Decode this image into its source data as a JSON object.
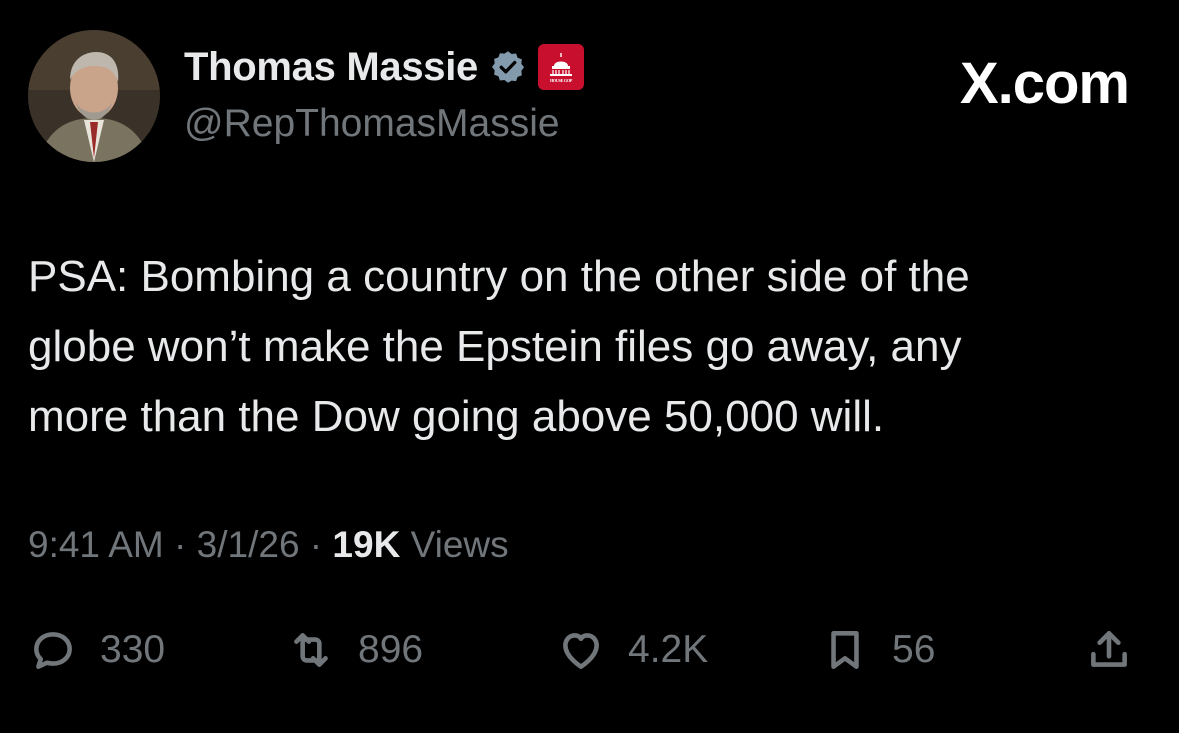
{
  "author": {
    "name": "Thomas Massie",
    "handle": "@RepThomasMassie",
    "verified_icon": "verified-badge-icon",
    "affiliation_icon": "house-gop-capitol-icon",
    "affiliation_text": "HOUSE GOP"
  },
  "brand": "X.com",
  "tweet": {
    "text": "PSA: Bombing a country on the other side of the\nglobe won’t make the Epstein files go away, any\nmore than the Dow going above 50,000 will."
  },
  "meta": {
    "time": "9:41 AM",
    "date": "3/1/26",
    "separator": " · ",
    "views_count": "19K",
    "views_label": "Views"
  },
  "actions": {
    "replies": "330",
    "reposts": "896",
    "likes": "4.2K",
    "bookmarks": "56"
  },
  "colors": {
    "background": "#000000",
    "text": "#e7e9ea",
    "secondary": "#71767b",
    "affiliation_bg": "#c8102e"
  }
}
